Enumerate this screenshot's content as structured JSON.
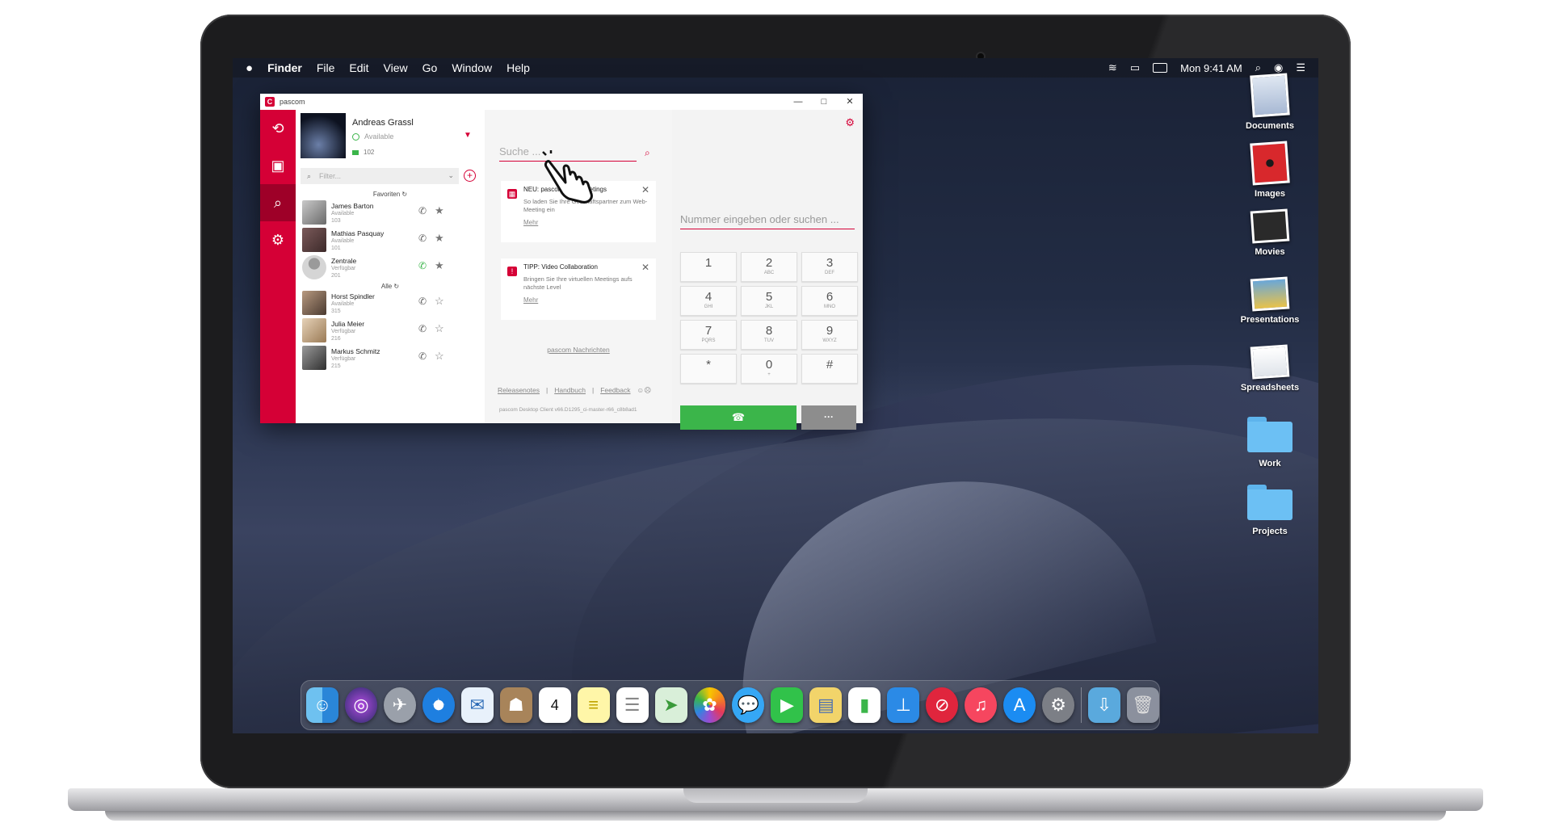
{
  "menubar": {
    "apple": "",
    "items": [
      "Finder",
      "File",
      "Edit",
      "View",
      "Go",
      "Window",
      "Help"
    ],
    "clock": "Mon 9:41 AM"
  },
  "desktop_icons": [
    "Documents",
    "Images",
    "Movies",
    "Presentations",
    "Spreadsheets",
    "Work",
    "Projects"
  ],
  "pascom": {
    "title": "pascom",
    "window_controls": [
      "—",
      "□",
      "✕"
    ],
    "me": {
      "name": "Andreas Grassl",
      "status": "Available",
      "extension": "102"
    },
    "filter_placeholder": "Filter...",
    "favorites_header": "Favoriten",
    "all_header": "Alle",
    "favorites": [
      {
        "name": "James Barton",
        "status": "Available",
        "ext": "103"
      },
      {
        "name": "Mathias Pasquay",
        "status": "Available",
        "ext": "101"
      },
      {
        "name": "Zentrale",
        "status": "Verfügbar",
        "ext": "201"
      }
    ],
    "all": [
      {
        "name": "Horst Spindler",
        "status": "Available",
        "ext": "315"
      },
      {
        "name": "Julia Meier",
        "status": "Verfügbar",
        "ext": "216"
      },
      {
        "name": "Markus Schmitz",
        "status": "Verfügbar",
        "ext": "215"
      }
    ],
    "search_placeholder": "Suche ...",
    "cards": [
      {
        "title": "NEU: pascom Web-Meetings",
        "body": "So laden Sie Ihre Geschäftspartner zum Web-Meeting ein",
        "more": "Mehr"
      },
      {
        "title": "TIPP: Video Collaboration",
        "body": "Bringen Sie Ihre virtuellen Meetings aufs nächste Level",
        "more": "Mehr"
      }
    ],
    "messages_link": "pascom Nachrichten",
    "footer": {
      "release": "Releasenotes",
      "manual": "Handbuch",
      "feedback": "Feedback",
      "sep": "|"
    },
    "version": "pascom Desktop Client v66.D1295_ci-master-r66_c8b8ad1",
    "dial_placeholder": "Nummer eingeben oder suchen ...",
    "keys": [
      {
        "d": "1",
        "l": ""
      },
      {
        "d": "2",
        "l": "ABC"
      },
      {
        "d": "3",
        "l": "DEF"
      },
      {
        "d": "4",
        "l": "GHI"
      },
      {
        "d": "5",
        "l": "JKL"
      },
      {
        "d": "6",
        "l": "MNO"
      },
      {
        "d": "7",
        "l": "PQRS"
      },
      {
        "d": "8",
        "l": "TUV"
      },
      {
        "d": "9",
        "l": "WXYZ"
      },
      {
        "d": "*",
        "l": ""
      },
      {
        "d": "0",
        "l": "+"
      },
      {
        "d": "#",
        "l": ""
      }
    ],
    "call_icon": "☎",
    "more_label": "···"
  },
  "colors": {
    "accent": "#d50036",
    "green": "#3bb54a"
  }
}
